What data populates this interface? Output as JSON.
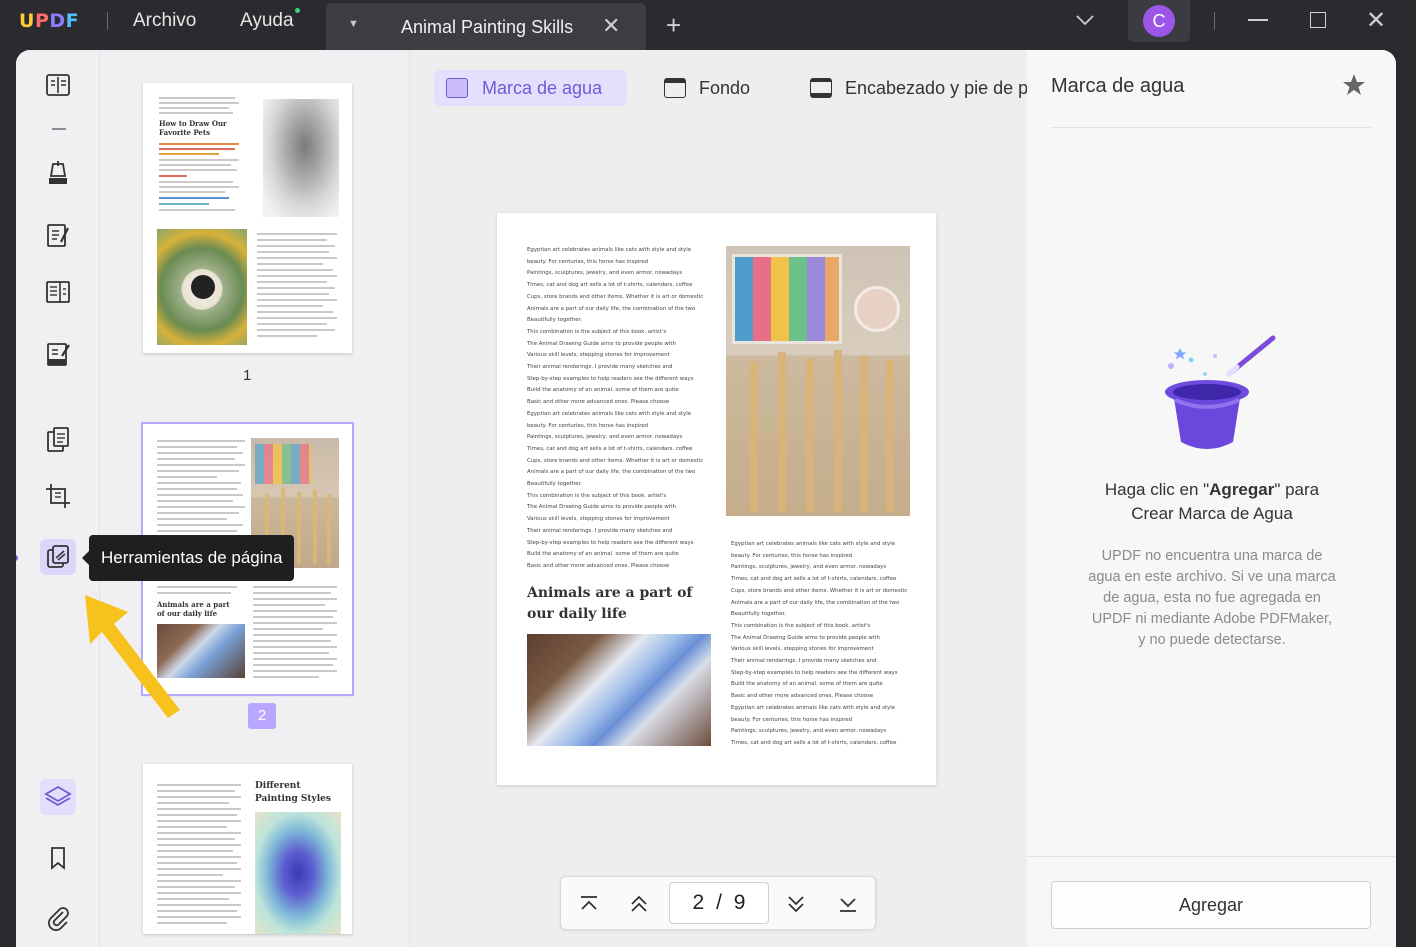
{
  "app": {
    "logo": {
      "u": "U",
      "p": "P",
      "d": "D",
      "f": "F"
    },
    "menus": [
      "Archivo",
      "Ayuda"
    ],
    "tab_title": "Animal Painting Skills",
    "avatar_initial": "C"
  },
  "sidebar": {
    "tooltip": "Herramientas de página",
    "tools": [
      "reader-icon",
      "comment-icon",
      "edit-icon",
      "organize-icon",
      "form-icon",
      "convert-icon",
      "crop-icon",
      "page-tools-icon",
      "layers-icon",
      "bookmark-icon",
      "attachment-icon"
    ]
  },
  "thumbnails": {
    "pages": [
      {
        "number": "1",
        "title": "How to Draw Our Favorite Pets"
      },
      {
        "number": "2",
        "title": "Animals are a part of our daily life"
      },
      {
        "number": "",
        "title": "Different Painting Styles"
      }
    ]
  },
  "toolbar": {
    "tabs": [
      "Marca de agua",
      "Fondo",
      "Encabezado y pie de p"
    ]
  },
  "document": {
    "paragraph1": "Egyptian art celebrates animals like cats with style and style\nbeauty. For centuries, this horse has inspired\nPaintings, sculptures, jewelry, and even armor. nowadays\nTimes, cat and dog art sells a lot of t-shirts, calendars, coffee\nCups, store brands and other items. Whether it is art or domestic\nAnimals are a part of our daily life, the combination of the two\nBeautifully together.\nThis combination is the subject of this book. artist's\nThe Animal Drawing Guide aims to provide people with\nVarious skill levels, stepping stones for improvement\nTheir animal renderings. I provide many sketches and\nStep-by-step examples to help readers see the different ways\nBuild the anatomy of an animal. some of them are quite\nBasic and other more advanced ones. Please choose\nEgyptian art celebrates animals like cats with style and style\nbeauty. For centuries, this horse has inspired\nPaintings, sculptures, jewelry, and even armor. nowadays\nTimes, cat and dog art sells a lot of t-shirts, calendars, coffee\nCups, store brands and other items. Whether it is art or domestic\nAnimals are a part of our daily life, the combination of the two\nBeautifully together.\nThis combination is the subject of this book. artist's\nThe Animal Drawing Guide aims to provide people with\nVarious skill levels, stepping stones for improvement\nTheir animal renderings. I provide many sketches and\nStep-by-step examples to help readers see the different ways\nBuild the anatomy of an animal. some of them are quite\nBasic and other more advanced ones. Please choose",
    "heading": "Animals are a part of our daily life",
    "paragraph2": "Egyptian art celebrates animals like cats with style and style\nbeauty. For centuries, this horse has inspired\nPaintings, sculptures, jewelry, and even armor. nowadays\nTimes, cat and dog art sells a lot of t-shirts, calendars, coffee\nCups, store brands and other items. Whether it is art or domestic\nAnimals are a part of our daily life, the combination of the two\nBeautifully together.\nThis combination is the subject of this book. artist's\nThe Animal Drawing Guide aims to provide people with\nVarious skill levels, stepping stones for improvement\nTheir animal renderings. I provide many sketches and\nStep-by-step examples to help readers see the different ways\nBuild the anatomy of an animal. some of them are quite\nBasic and other more advanced ones. Please choose\nEgyptian art celebrates animals like cats with style and style\nbeauty. For centuries, this horse has inspired\nPaintings, sculptures, jewelry, and even armor. nowadays\nTimes, cat and dog art sells a lot of t-shirts, calendars, coffee"
  },
  "pager": {
    "current": "2",
    "separator": "/",
    "total": "9"
  },
  "panel": {
    "title": "Marca de agua",
    "msg_prefix": "Haga clic en \"",
    "msg_bold": "Agregar",
    "msg_suffix": "\" para",
    "msg_line2": "Crear Marca de Agua",
    "description": "UPDF no encuentra una marca de agua en este archivo. Si ve una marca de agua, esta no fue agregada en UPDF ni mediante Adobe PDFMaker, y no puede detectarse.",
    "add_button": "Agregar"
  },
  "colors": {
    "accent": "#6f5bd6",
    "accent_light": "#e6defd",
    "selection": "#b9a6ff",
    "avatar": "#9b55e8",
    "arrow": "#f7c21e",
    "titlebar": "#2b2b2f"
  }
}
